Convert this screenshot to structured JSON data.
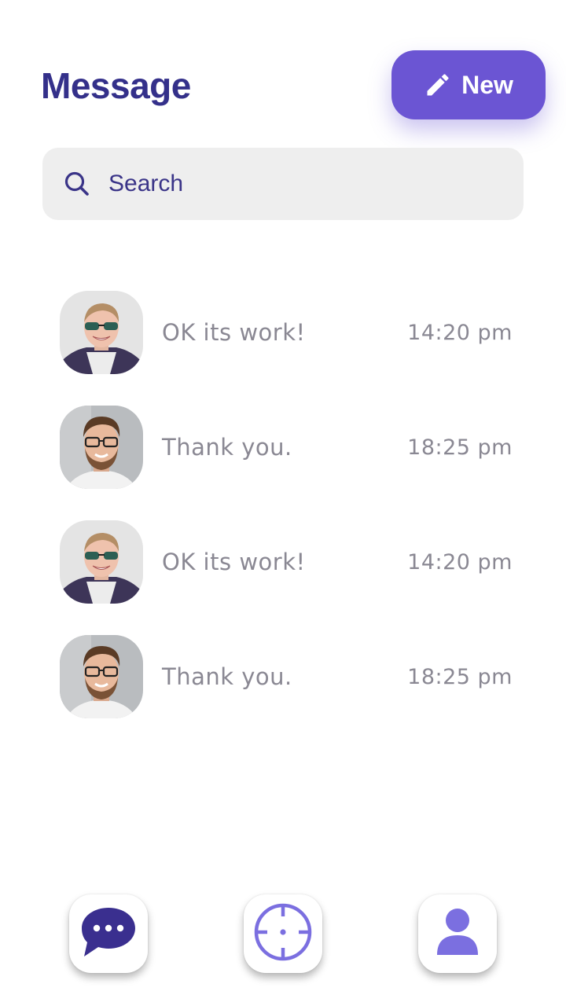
{
  "header": {
    "title": "Message",
    "new_label": "New"
  },
  "search": {
    "placeholder": "Search"
  },
  "conversations": [
    {
      "message": "OK its work!",
      "time": "14:20 pm",
      "avatar": "blonde-man-sunglasses"
    },
    {
      "message": "Thank you.",
      "time": "18:25 pm",
      "avatar": "bearded-man-glasses"
    },
    {
      "message": "OK its work!",
      "time": "14:20 pm",
      "avatar": "blonde-man-sunglasses"
    },
    {
      "message": "Thank you.",
      "time": "18:25 pm",
      "avatar": "bearded-man-glasses"
    }
  ],
  "bottom_nav": [
    {
      "icon": "chat-bubble-icon",
      "active": true
    },
    {
      "icon": "crosshair-icon",
      "active": false
    },
    {
      "icon": "user-icon",
      "active": false
    }
  ],
  "colors": {
    "primary": "#6b55d3",
    "title": "#34308a",
    "nav_dark": "#3a2f8f",
    "nav_light": "#7b6fe0",
    "muted_text": "#8a8893",
    "search_bg": "#eeeeee"
  }
}
